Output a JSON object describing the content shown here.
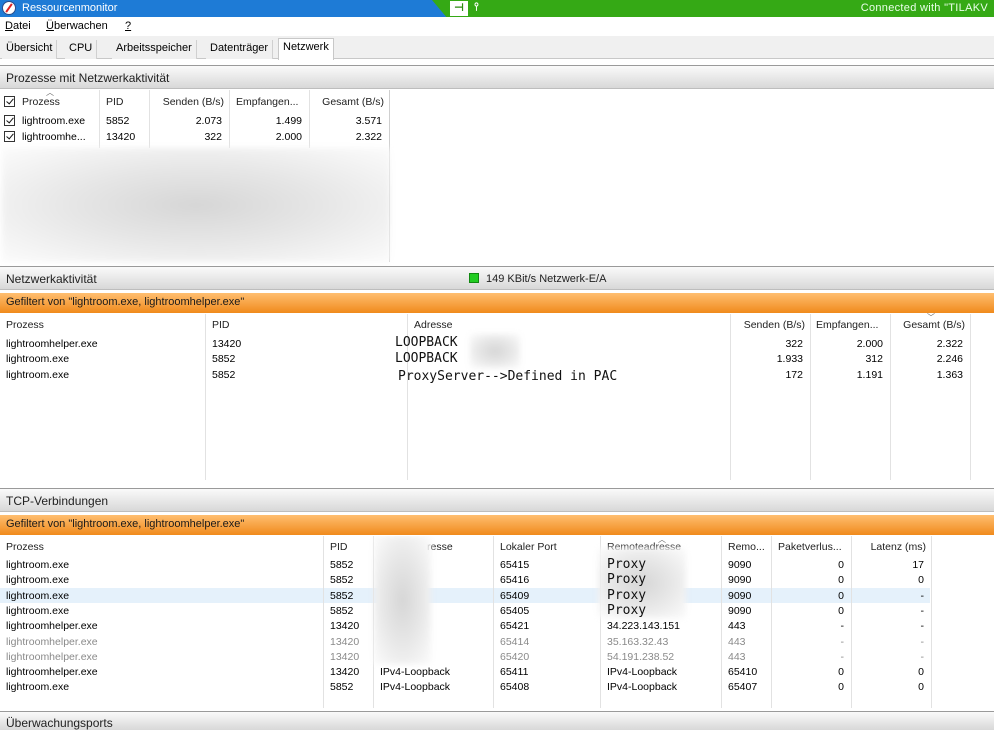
{
  "window": {
    "title": "Ressourcenmonitor",
    "remote_status": "Connected with \"TILAKV"
  },
  "menu": [
    {
      "label": "Datei"
    },
    {
      "label": "Überwachen"
    },
    {
      "label": "?"
    }
  ],
  "tabs": [
    {
      "label": "Übersicht"
    },
    {
      "label": "CPU"
    },
    {
      "label": "Arbeitsspeicher"
    },
    {
      "label": "Datenträger"
    },
    {
      "label": "Netzwerk"
    }
  ],
  "processes_section": {
    "title": "Prozesse mit Netzwerkaktivität",
    "columns": [
      "Prozess",
      "PID",
      "Senden (B/s)",
      "Empfangen...",
      "Gesamt (B/s)"
    ],
    "rows": [
      {
        "name": "lightroom.exe",
        "pid": "5852",
        "send": "2.073",
        "recv": "1.499",
        "total": "3.571"
      },
      {
        "name": "lightroomhe...",
        "pid": "13420",
        "send": "322",
        "recv": "2.000",
        "total": "2.322"
      }
    ]
  },
  "network_section": {
    "title": "Netzwerkaktivität",
    "io_label": "149 KBit/s Netzwerk-E/A",
    "filter": "Gefiltert von \"lightroom.exe, lightroomhelper.exe\"",
    "columns": [
      "Prozess",
      "PID",
      "Adresse",
      "Senden (B/s)",
      "Empfangen...",
      "Gesamt (B/s)"
    ],
    "rows": [
      {
        "name": "lightroomhelper.exe",
        "pid": "13420",
        "addr": "LOOPBACK",
        "send": "322",
        "recv": "2.000",
        "total": "2.322"
      },
      {
        "name": "lightroom.exe",
        "pid": "5852",
        "addr": "LOOPBACK",
        "send": "1.933",
        "recv": "312",
        "total": "2.246"
      },
      {
        "name": "lightroom.exe",
        "pid": "5852",
        "addr": "ProxyServer-->Defined in PAC",
        "send": "172",
        "recv": "1.191",
        "total": "1.363"
      }
    ]
  },
  "tcp_section": {
    "title": "TCP-Verbindungen",
    "filter": "Gefiltert von \"lightroom.exe, lightroomhelper.exe\"",
    "columns": [
      "Prozess",
      "PID",
      "resse",
      "Lokaler Port",
      "Remoteadresse",
      "Remo...",
      "Paketverlus...",
      "Latenz (ms)"
    ],
    "rows": [
      {
        "name": "lightroom.exe",
        "pid": "5852",
        "local": "",
        "lport": "65415",
        "remote": "Proxy",
        "rport": "9090",
        "loss": "0",
        "lat": "17",
        "gray": false,
        "mono": true,
        "sel": false
      },
      {
        "name": "lightroom.exe",
        "pid": "5852",
        "local": "",
        "lport": "65416",
        "remote": "Proxy",
        "rport": "9090",
        "loss": "0",
        "lat": "0",
        "gray": false,
        "mono": true,
        "sel": false
      },
      {
        "name": "lightroom.exe",
        "pid": "5852",
        "local": "",
        "lport": "65409",
        "remote": "Proxy",
        "rport": "9090",
        "loss": "0",
        "lat": "-",
        "gray": false,
        "mono": true,
        "sel": true
      },
      {
        "name": "lightroom.exe",
        "pid": "5852",
        "local": "",
        "lport": "65405",
        "remote": "Proxy",
        "rport": "9090",
        "loss": "0",
        "lat": "-",
        "gray": false,
        "mono": true,
        "sel": false
      },
      {
        "name": "lightroomhelper.exe",
        "pid": "13420",
        "local": "",
        "lport": "65421",
        "remote": "34.223.143.151",
        "rport": "443",
        "loss": "-",
        "lat": "-",
        "gray": false,
        "mono": false,
        "sel": false
      },
      {
        "name": "lightroomhelper.exe",
        "pid": "13420",
        "local": "",
        "lport": "65414",
        "remote": "35.163.32.43",
        "rport": "443",
        "loss": "-",
        "lat": "-",
        "gray": true,
        "mono": false,
        "sel": false
      },
      {
        "name": "lightroomhelper.exe",
        "pid": "13420",
        "local": "",
        "lport": "65420",
        "remote": "54.191.238.52",
        "rport": "443",
        "loss": "-",
        "lat": "-",
        "gray": true,
        "mono": false,
        "sel": false
      },
      {
        "name": "lightroomhelper.exe",
        "pid": "13420",
        "local": "IPv4-Loopback",
        "lport": "65411",
        "remote": "IPv4-Loopback",
        "rport": "65410",
        "loss": "0",
        "lat": "0",
        "gray": false,
        "mono": false,
        "sel": false
      },
      {
        "name": "lightroom.exe",
        "pid": "5852",
        "local": "IPv4-Loopback",
        "lport": "65408",
        "remote": "IPv4-Loopback",
        "rport": "65407",
        "loss": "0",
        "lat": "0",
        "gray": false,
        "mono": false,
        "sel": false
      }
    ]
  },
  "ports_section": {
    "title": "Überwachungsports"
  }
}
